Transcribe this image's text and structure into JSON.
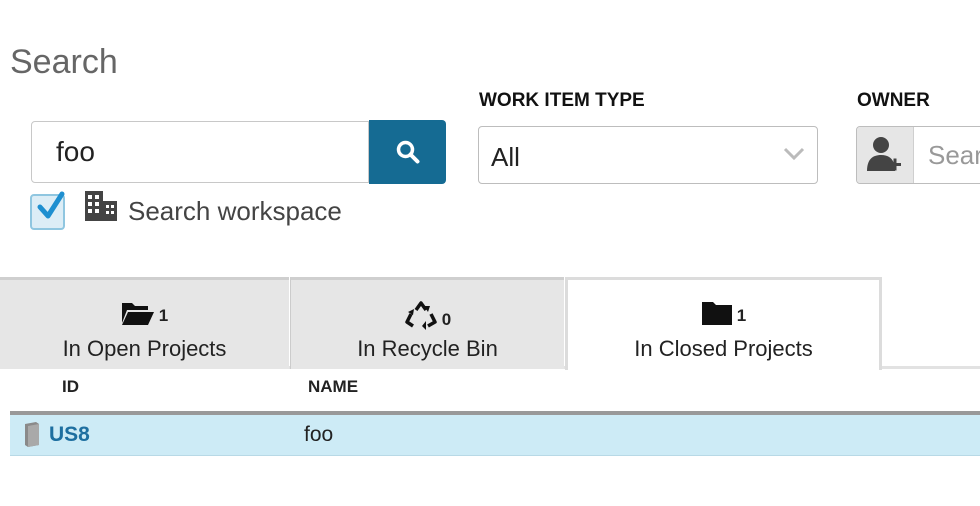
{
  "page": {
    "title": "Search"
  },
  "search": {
    "value": "foo",
    "button_icon": "search-icon"
  },
  "workspace_option": {
    "label": "Search workspace",
    "checked": true,
    "icon": "building-icon"
  },
  "work_item_type": {
    "label": "WORK ITEM TYPE",
    "selected": "All"
  },
  "owner": {
    "label": "OWNER",
    "placeholder": "Search",
    "icon": "add-user-icon"
  },
  "tabs": [
    {
      "icon": "open-folder-icon",
      "count": "1",
      "label": "In Open Projects",
      "active": false
    },
    {
      "icon": "recycle-icon",
      "count": "0",
      "label": "In Recycle Bin",
      "active": false
    },
    {
      "icon": "folder-icon",
      "count": "1",
      "label": "In Closed Projects",
      "active": true
    }
  ],
  "table": {
    "columns": [
      "ID",
      "NAME"
    ],
    "rows": [
      {
        "id": "US8",
        "name": "foo",
        "icon": "book-icon",
        "selected": true
      }
    ]
  },
  "colors": {
    "accent": "#156b93",
    "row_highlight": "#cdebf6",
    "link": "#1e6fa0"
  }
}
